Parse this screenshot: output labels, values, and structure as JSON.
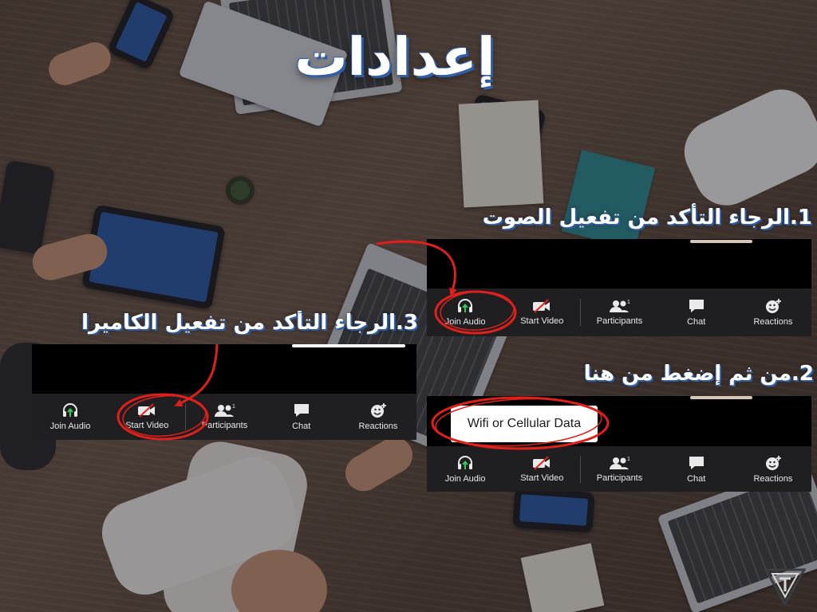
{
  "title": "إعدادات",
  "steps": {
    "audio": "1.الرجاء التأكد من تفعيل الصوت",
    "press_here": "2.من ثم إضغط من هنا",
    "camera": "3.الرجاء التأكد من تفعيل الكاميرا"
  },
  "toolbar": {
    "join_audio": "Join Audio",
    "start_video": "Start Video",
    "participants": "Participants",
    "participants_count": "1",
    "chat": "Chat",
    "reactions": "Reactions"
  },
  "popup": {
    "label": "Wifi or Cellular Data"
  },
  "colors": {
    "annotation_red": "#e0201b",
    "heading_shadow": "#2e5ea6",
    "toolbar_bg": "#1f1f21",
    "audio_green": "#35c759"
  },
  "icons": {
    "join_audio": "headphones-icon",
    "start_video": "video-off-icon",
    "participants": "participants-icon",
    "chat": "chat-bubble-icon",
    "reactions": "smiley-plus-icon",
    "arrow": "curved-arrow-icon",
    "logo": "triangle-logo"
  }
}
